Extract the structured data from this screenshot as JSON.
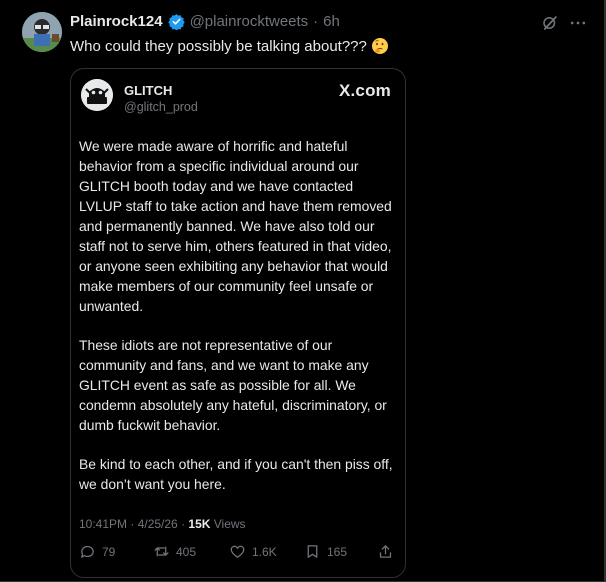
{
  "tweet": {
    "display_name": "Plainrock124",
    "handle": "@plainrocktweets",
    "separator": "·",
    "time_ago": "6h",
    "text": "Who could they possibly be talking about???",
    "emoji": "thinking-face-emoji"
  },
  "header_icons": [
    "grok-icon",
    "more-icon"
  ],
  "embedded": {
    "name": "GLITCH",
    "handle": "@glitch_prod",
    "source": "X.com",
    "paragraphs": [
      "We were made aware of horrific and hateful behavior from a specific individual around our GLITCH booth today and we have contacted LVLUP staff to take action and have them removed and permanently banned. We have also told our staff not to serve him, others featured in that video, or anyone seen exhibiting any behavior that would make members of our community feel unsafe or unwanted.",
      "These idiots are not representative of our community and fans, and we want to make any GLITCH event as safe as possible for all. We condemn absolutely any hateful, discriminatory, or dumb fuckwit behavior.",
      "Be kind to each other, and if you can't then piss off, we don’t want you here."
    ],
    "timestamp": "10:41PM · 4/25/26 ·",
    "views_count": "15K",
    "views_label": "Views",
    "actions": {
      "replies": "79",
      "reposts": "405",
      "likes": "1.6K",
      "bookmarks": "165"
    }
  },
  "colors": {
    "background": "#000000",
    "text": "#e7e9ea",
    "muted": "#71767b",
    "border": "#2f3336",
    "verified": "#1d9bf0",
    "emoji": "#ffcc4d"
  }
}
